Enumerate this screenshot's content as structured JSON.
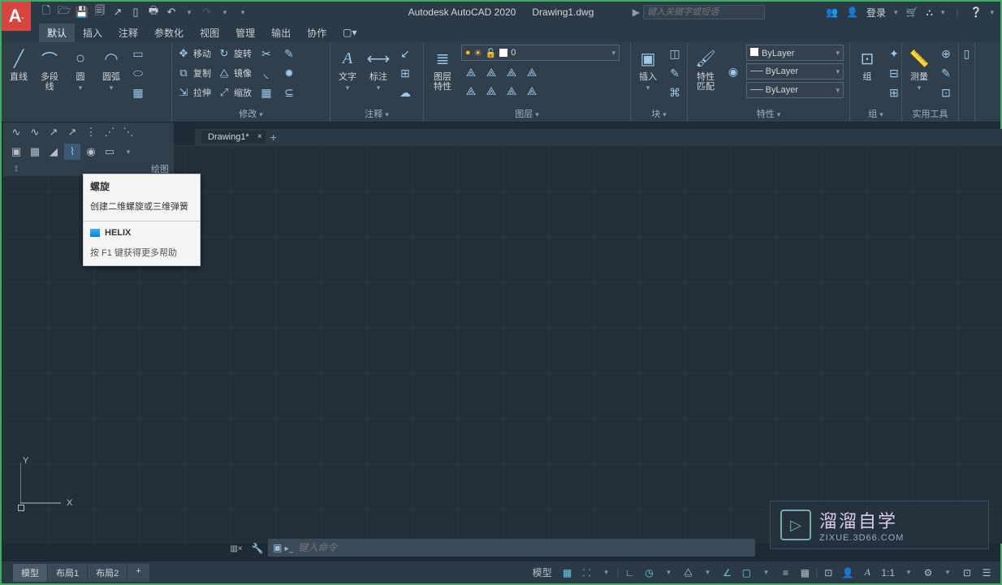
{
  "title": {
    "app": "Autodesk AutoCAD 2020",
    "doc": "Drawing1.dwg"
  },
  "search_placeholder": "键入关键字或短语",
  "login": "登录",
  "menu": [
    "默认",
    "插入",
    "注释",
    "参数化",
    "视图",
    "管理",
    "输出",
    "协作"
  ],
  "ribbon": {
    "draw": {
      "title": "",
      "line": "直线",
      "polyline": "多段线",
      "circle": "圆",
      "arc": "圆弧"
    },
    "modify": {
      "title": "修改",
      "move": "移动",
      "copy": "复制",
      "stretch": "拉伸",
      "rotate": "旋转",
      "mirror": "镜像",
      "scale": "缩放"
    },
    "annot": {
      "title": "注释",
      "text": "文字",
      "dim": "标注"
    },
    "layer": {
      "title": "图层",
      "props": "图层\n特性",
      "current": "0"
    },
    "block": {
      "title": "块",
      "insert": "插入"
    },
    "props": {
      "title": "特性",
      "match": "特性\n匹配",
      "bylayer": "ByLayer"
    },
    "group": {
      "title": "组",
      "group": "组"
    },
    "util": {
      "title": "实用工具",
      "measure": "测量"
    }
  },
  "draw_panel_label": "绘图",
  "drawing_tab": "Drawing1*",
  "tooltip": {
    "title": "螺旋",
    "desc": "创建二维螺旋或三维弹簧",
    "cmd": "HELIX",
    "help": "按 F1 键获得更多帮助"
  },
  "cmd_placeholder": "键入命令",
  "model_tabs": [
    "模型",
    "布局1",
    "布局2"
  ],
  "status": {
    "model": "模型",
    "ratio": "1:1"
  },
  "watermark": {
    "zh": "溜溜自学",
    "en": "ZIXUE.3D66.COM"
  },
  "ucs": {
    "x": "X",
    "y": "Y"
  }
}
